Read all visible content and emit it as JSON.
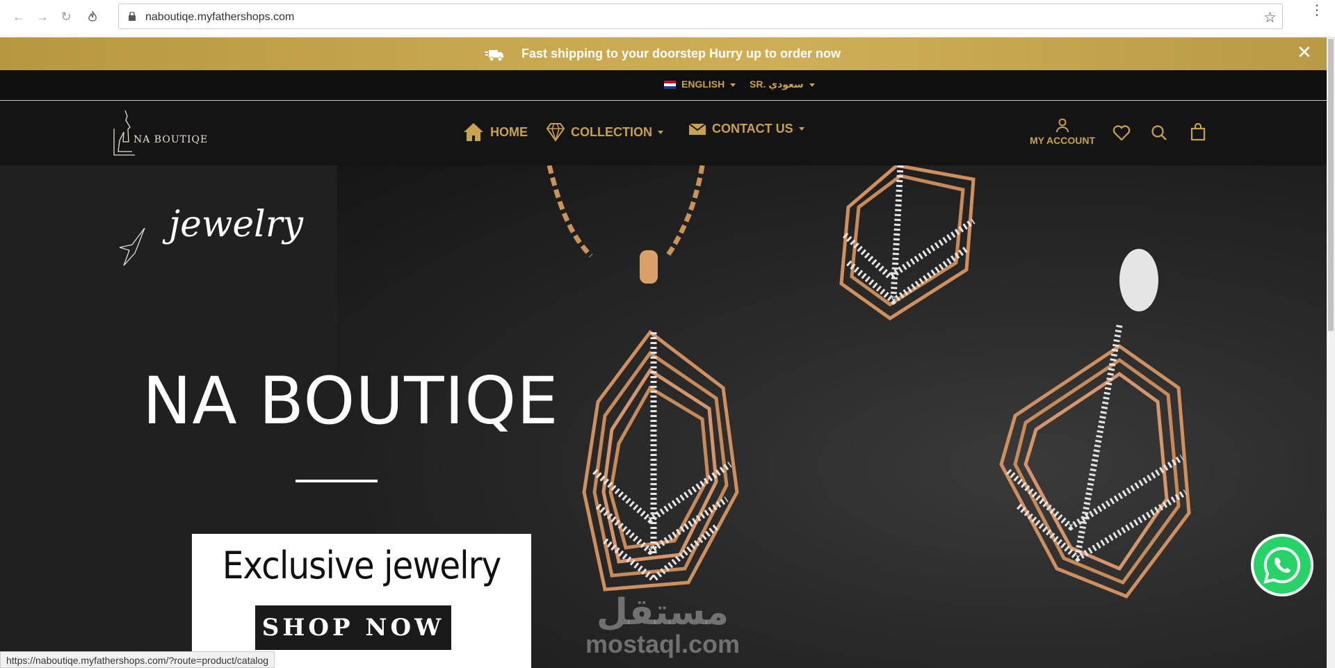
{
  "browser": {
    "url": "naboutiqe.myfathershops.com",
    "status_url": "https://naboutiqe.myfathershops.com/?route=product/catalog"
  },
  "announcement": {
    "message": "Fast shipping to your doorstep Hurry up to order now",
    "close": "✕"
  },
  "lang_bar": {
    "language": "ENGLISH",
    "currency": "SR. سعودي"
  },
  "header": {
    "logo_text": "NA BOUTIQE",
    "menu": [
      {
        "label": "HOME",
        "icon": "home-icon"
      },
      {
        "label": "COLLECTION",
        "icon": "diamond-icon"
      },
      {
        "label": "CONTACT US",
        "icon": "envelope-icon"
      }
    ],
    "account_label": "MY ACCOUNT"
  },
  "hero": {
    "script_text": "jewelry",
    "title": "NA BOUTIQE",
    "promo_headline": "Exclusive jewelry",
    "cta": "SHOP NOW"
  },
  "watermark": {
    "arabic": "مستقل",
    "domain": "mostaql.com"
  },
  "colors": {
    "gold": "#c8a24c",
    "announce_bg": "#c5a54c",
    "header_bg": "#141414",
    "whatsapp": "#25d366"
  }
}
